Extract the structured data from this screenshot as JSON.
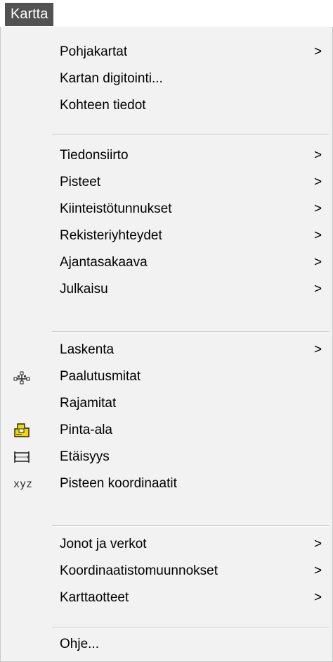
{
  "menubar": {
    "title": "Kartta"
  },
  "menu": {
    "items": [
      {
        "label": "Pohjakartat",
        "submenu": true
      },
      {
        "label": "Kartan digitointi...",
        "submenu": false
      },
      {
        "label": "Kohteen tiedot",
        "submenu": false
      },
      {
        "label": "Tiedonsiirto",
        "submenu": true
      },
      {
        "label": "Pisteet",
        "submenu": true
      },
      {
        "label": "Kiinteistötunnukset",
        "submenu": true
      },
      {
        "label": "Rekisteriyhteydet",
        "submenu": true
      },
      {
        "label": "Ajantasakaava",
        "submenu": true
      },
      {
        "label": "Julkaisu",
        "submenu": true
      },
      {
        "label": "Laskenta",
        "submenu": true
      },
      {
        "label": "Paalutusmitat",
        "submenu": false,
        "icon": "staking-measure-icon"
      },
      {
        "label": "Rajamitat",
        "submenu": false
      },
      {
        "label": "Pinta-ala",
        "submenu": false,
        "icon": "area-icon"
      },
      {
        "label": "Etäisyys",
        "submenu": false,
        "icon": "distance-icon"
      },
      {
        "label": "Pisteen koordinaatit",
        "submenu": false,
        "icon": "xyz-icon",
        "icon_text": "xyz"
      },
      {
        "label": "Jonot ja verkot",
        "submenu": true
      },
      {
        "label": "Koordinaatistomuunnokset",
        "submenu": true
      },
      {
        "label": "Karttaotteet",
        "submenu": true
      },
      {
        "label": "Ohje...",
        "submenu": false
      }
    ],
    "arrow": ">"
  },
  "colors": {
    "menubar_highlight": "#525252",
    "menu_background": "#f2f2f2",
    "separator": "#c4c4c4",
    "area_icon_fill": "#f5d800"
  }
}
